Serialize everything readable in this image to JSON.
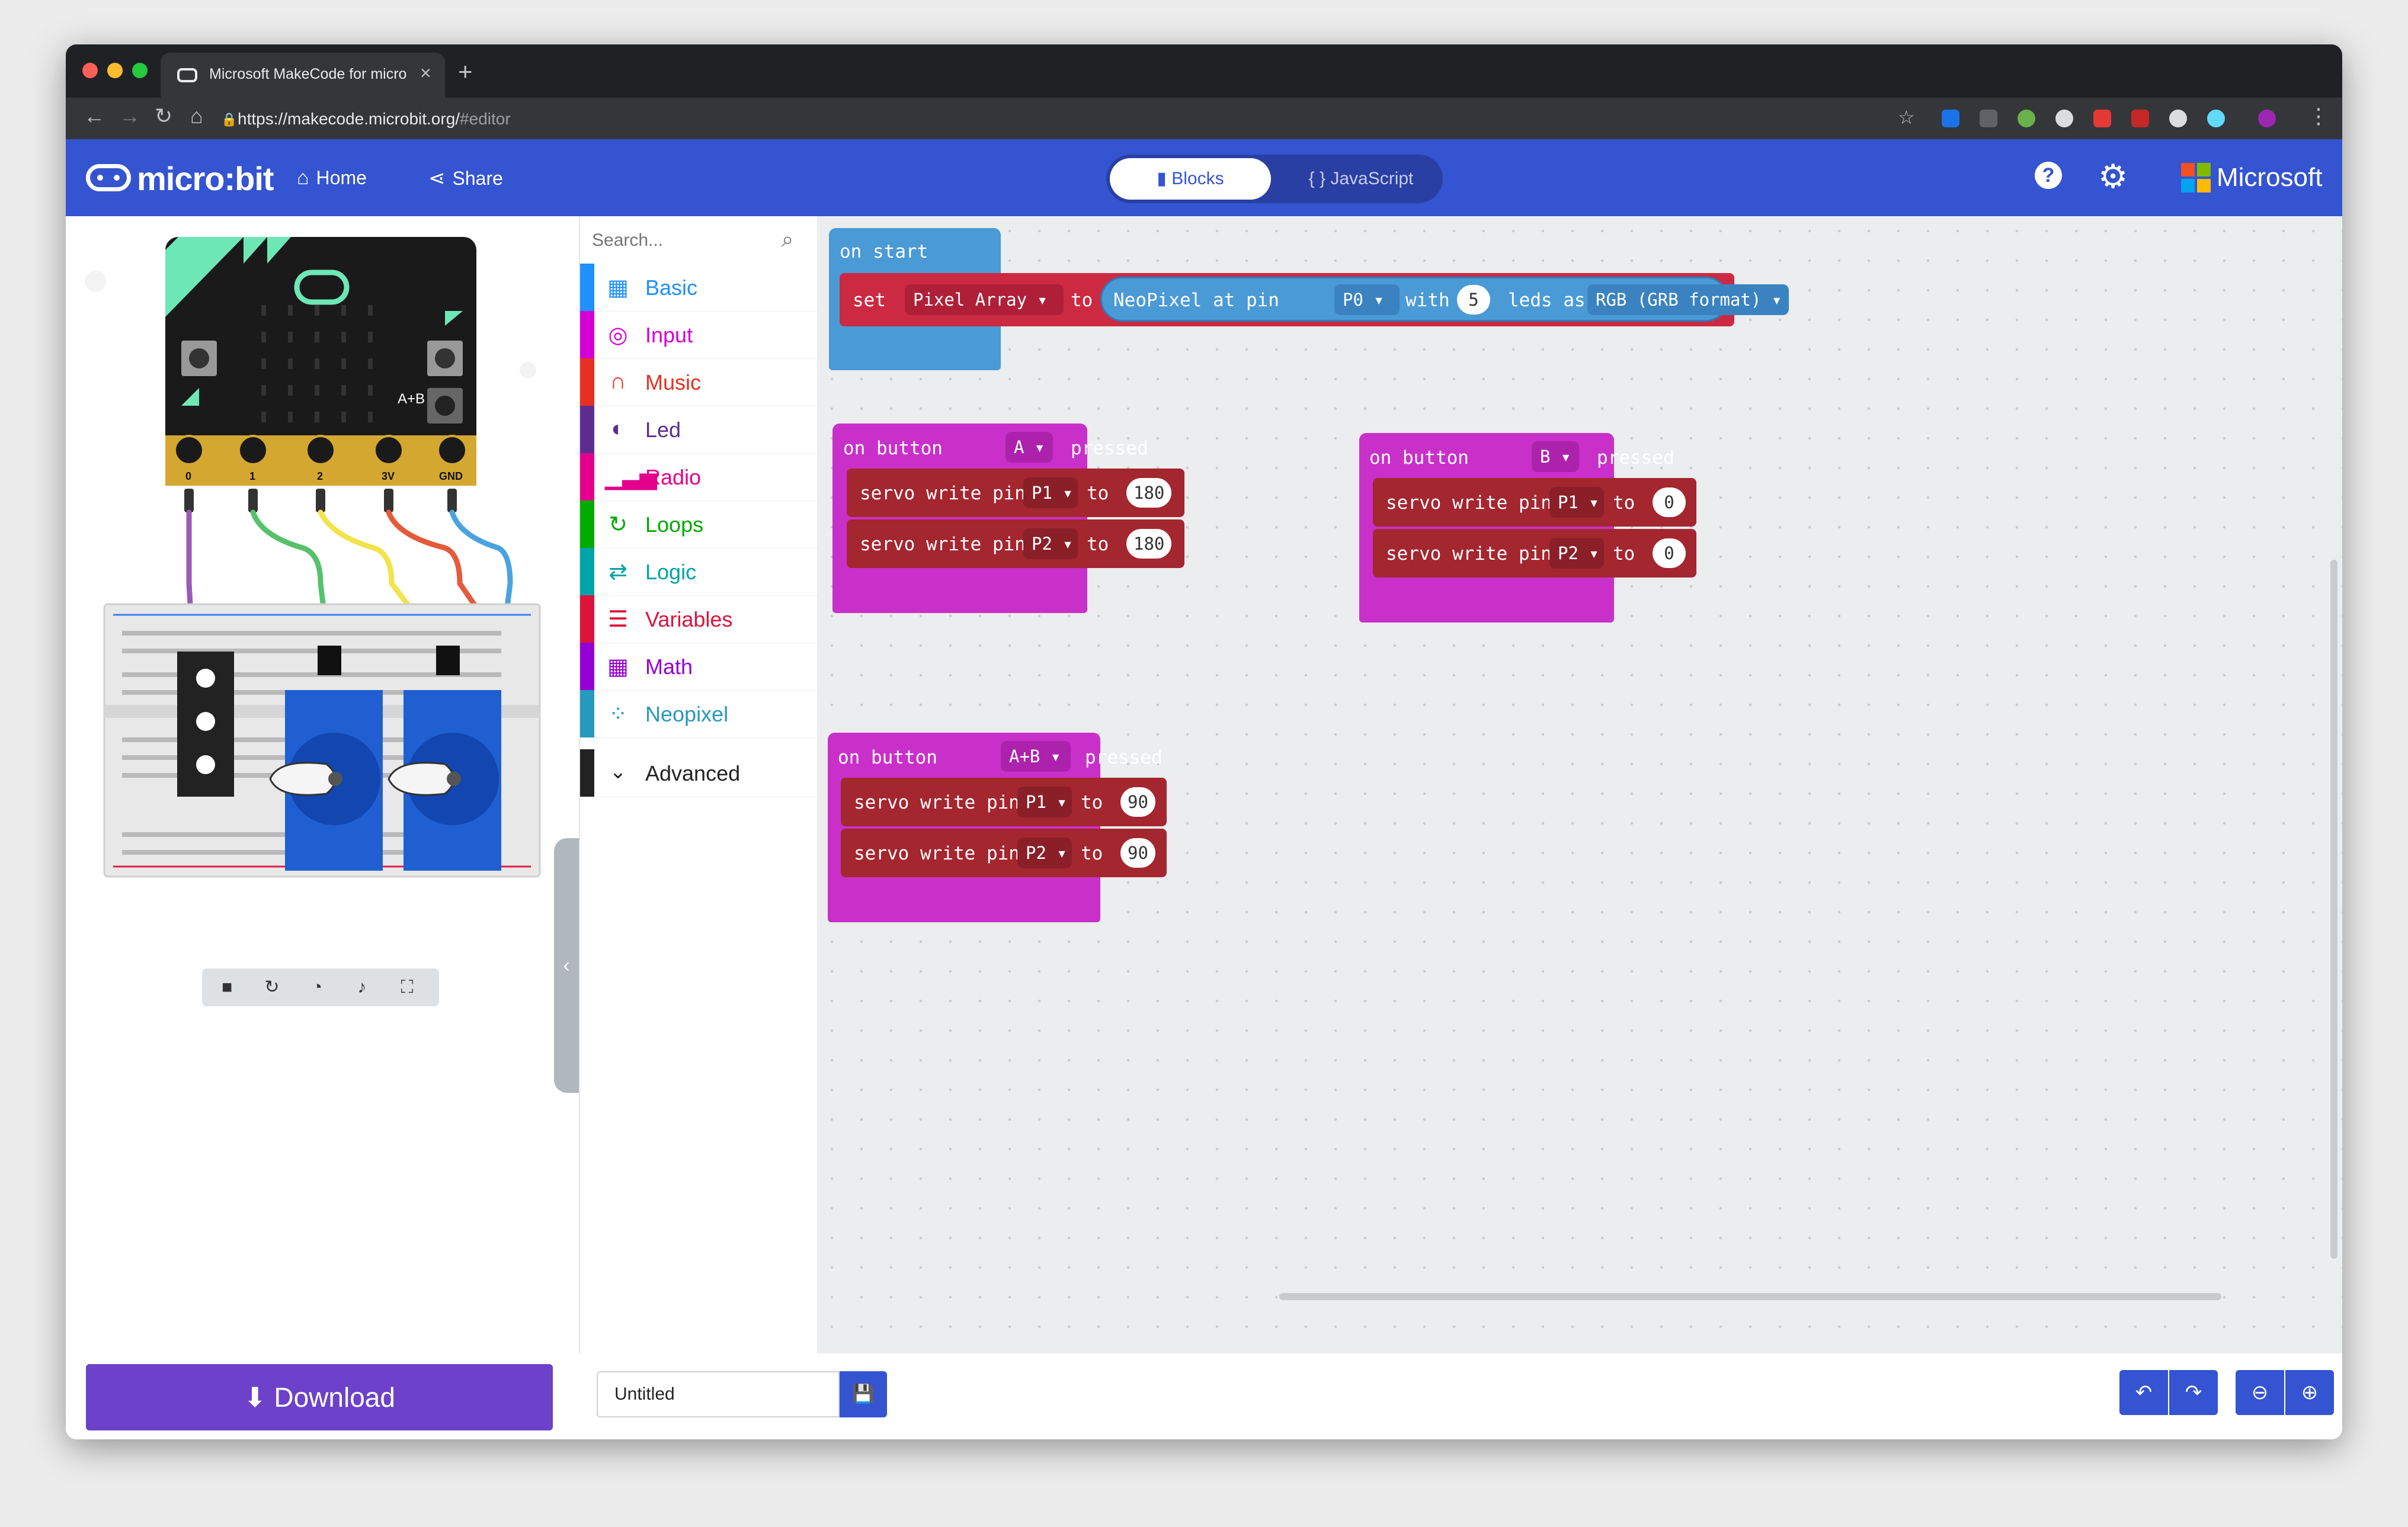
{
  "browser": {
    "tab_title": "Microsoft MakeCode for micro",
    "url_host": "https://makecode.microbit.org/",
    "url_path": "#editor"
  },
  "header": {
    "logo": "micro:bit",
    "home": "Home",
    "share": "Share",
    "blocks": "Blocks",
    "javascript": "{ } JavaScript",
    "brand": "Microsoft"
  },
  "simulator": {
    "pin_labels": [
      "0",
      "1",
      "2",
      "3V",
      "GND"
    ],
    "ab_label": "A+B"
  },
  "toolbox": {
    "search_placeholder": "Search...",
    "categories": [
      {
        "label": "Basic",
        "color": "#1e90ff"
      },
      {
        "label": "Input",
        "color": "#d400d4"
      },
      {
        "label": "Music",
        "color": "#e63022"
      },
      {
        "label": "Led",
        "color": "#5c2d91"
      },
      {
        "label": "Radio",
        "color": "#e3008c"
      },
      {
        "label": "Loops",
        "color": "#00aa00"
      },
      {
        "label": "Logic",
        "color": "#00a4a6"
      },
      {
        "label": "Variables",
        "color": "#dc143c"
      },
      {
        "label": "Math",
        "color": "#9400d3"
      },
      {
        "label": "Neopixel",
        "color": "#2699bf"
      }
    ],
    "advanced": "Advanced"
  },
  "blocks": {
    "on_start": {
      "hat": "on start",
      "set": "set",
      "var": "Pixel Array",
      "to": "to",
      "neopixel": "NeoPixel at pin",
      "pin": "P0",
      "with": "with",
      "count": "5",
      "leds_as": "leds as",
      "format": "RGB (GRB format)"
    },
    "button_a": {
      "on": "on button",
      "button": "A",
      "pressed": "pressed",
      "lines": [
        {
          "label": "servo write pin",
          "pin": "P1",
          "to": "to",
          "value": "180"
        },
        {
          "label": "servo write pin",
          "pin": "P2",
          "to": "to",
          "value": "180"
        }
      ]
    },
    "button_b": {
      "on": "on button",
      "button": "B",
      "pressed": "pressed",
      "lines": [
        {
          "label": "servo write pin",
          "pin": "P1",
          "to": "to",
          "value": "0"
        },
        {
          "label": "servo write pin",
          "pin": "P2",
          "to": "to",
          "value": "0"
        }
      ]
    },
    "button_ab": {
      "on": "on button",
      "button": "A+B",
      "pressed": "pressed",
      "lines": [
        {
          "label": "servo write pin",
          "pin": "P1",
          "to": "to",
          "value": "90"
        },
        {
          "label": "servo write pin",
          "pin": "P2",
          "to": "to",
          "value": "90"
        }
      ]
    }
  },
  "footer": {
    "download": "Download",
    "filename": "Untitled"
  },
  "colors": {
    "header_blue": "#3454d1",
    "event_magenta": "#c930c9",
    "servo_red": "#a4262f",
    "neopixel_blue": "#4a9ad6",
    "download_purple": "#6d41c9"
  }
}
